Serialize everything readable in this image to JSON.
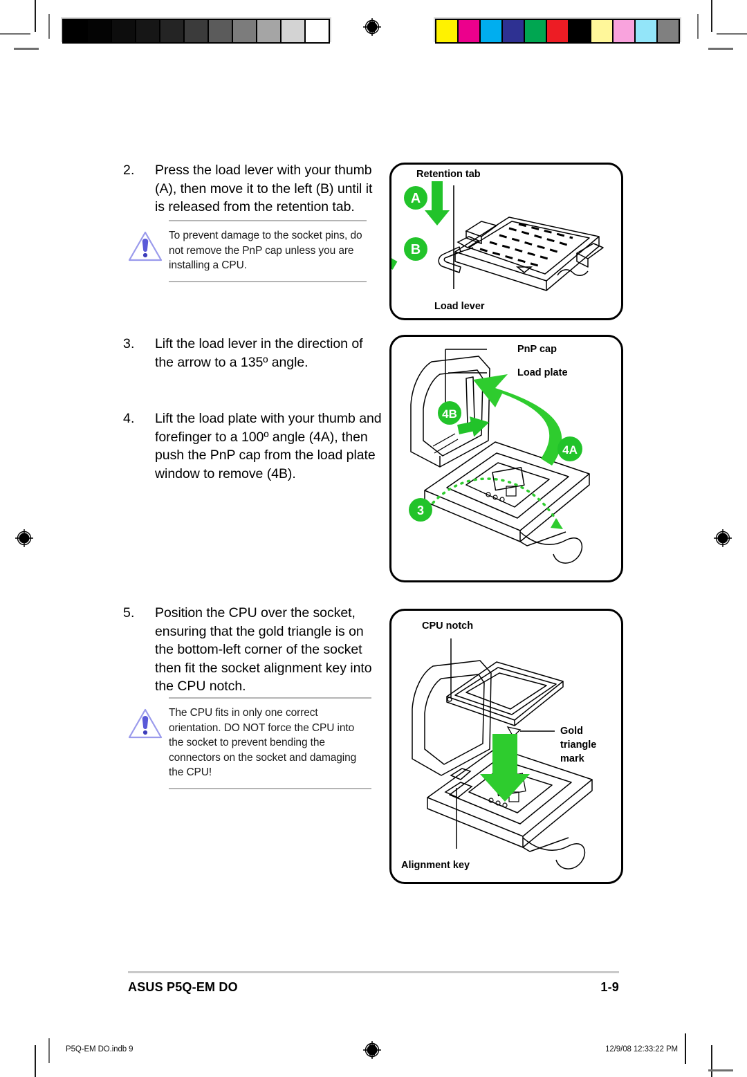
{
  "document": {
    "footer_left": "ASUS P5Q-EM DO",
    "footer_page": "1-9",
    "slug_file": "P5Q-EM DO.indb   9",
    "slug_datetime": "12/9/08   12:33:22 PM"
  },
  "calibration": {
    "grayscale_patches": [
      "#000000",
      "#040404",
      "#0d0d0d",
      "#161616",
      "#242424",
      "#3b3b3b",
      "#5b5b5b",
      "#7c7c7c",
      "#a5a5a5",
      "#d3d3d3",
      "#ffffff"
    ],
    "color_patches": [
      "#fff200",
      "#ec008c",
      "#00aeef",
      "#2e3192",
      "#00a651",
      "#ed1c24",
      "#000000",
      "#fff79a",
      "#f9a3dd",
      "#93e5f9",
      "#808080"
    ]
  },
  "steps": [
    {
      "number": "2.",
      "text": "Press the load lever with your thumb (A), then move it to the left (B) until it is released from the retention tab."
    },
    {
      "number": "3.",
      "text": "Lift the load lever in the direction of the arrow to a 135º angle."
    },
    {
      "number": "4.",
      "text": "Lift the load plate with your thumb and forefinger to a 100º angle (4A), then push the PnP cap from the load plate window to remove (4B)."
    },
    {
      "number": "5.",
      "text": "Position the CPU over the socket, ensuring that the gold triangle is on the bottom-left corner of the socket then fit the socket alignment key into the CPU notch."
    }
  ],
  "notes": [
    {
      "icon": "warning-icon",
      "text": "To prevent damage to the socket pins, do not remove the PnP cap unless you are installing a CPU."
    },
    {
      "icon": "warning-icon",
      "text": "The CPU fits in only one correct orientation. DO NOT force the CPU into the socket to prevent bending the connectors on the socket and damaging the CPU!"
    }
  ],
  "figures": [
    {
      "id": "figure-load-lever-release",
      "labels": {
        "top": "Retention tab",
        "bottom": "Load lever"
      },
      "badges": [
        "A",
        "B"
      ]
    },
    {
      "id": "figure-load-plate-pnp-cap",
      "labels": {
        "first": "PnP cap",
        "second": "Load plate"
      },
      "badges": [
        "4B",
        "4A",
        "3"
      ]
    },
    {
      "id": "figure-cpu-placement",
      "labels": {
        "top": "CPU notch",
        "right": "Gold triangle mark",
        "bottom": "Alignment key"
      }
    }
  ],
  "colors": {
    "badge_green": "#22c32a",
    "arrow_green": "#2ecc2e",
    "warning_icon": "#6b6be0",
    "rule_gray": "#b4b4b4"
  }
}
